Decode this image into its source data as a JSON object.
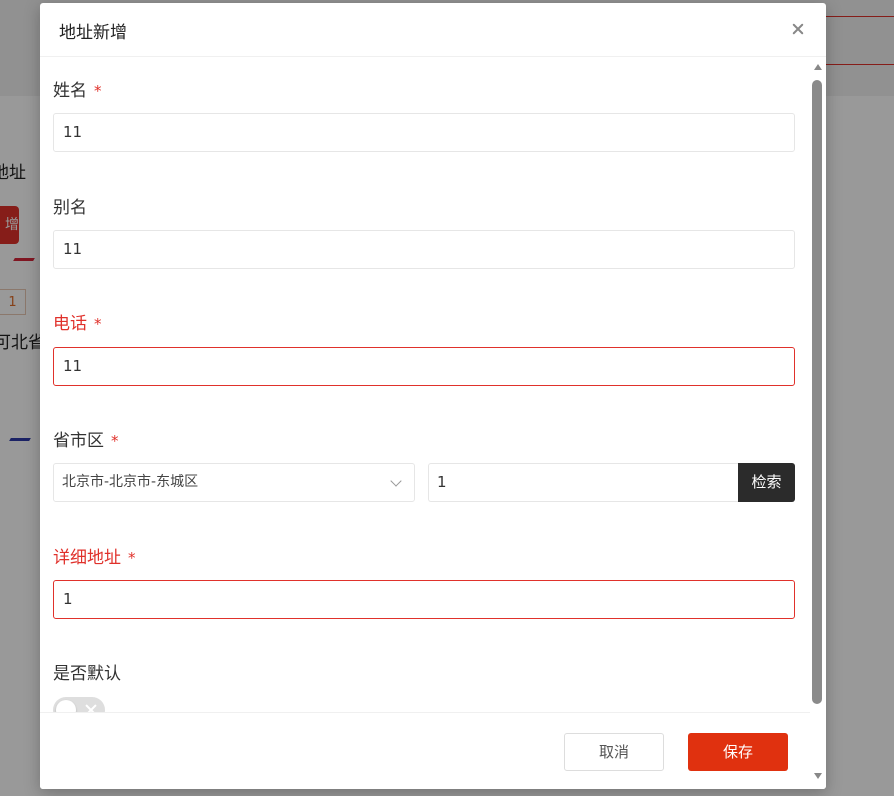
{
  "background": {
    "title_fragment": "地址",
    "button_fragment": "增",
    "tag_value": "1",
    "province_fragment": "可北省"
  },
  "modal": {
    "title": "地址新增",
    "required_mark": "*",
    "fields": {
      "name": {
        "label": "姓名",
        "value": "11"
      },
      "alias": {
        "label": "别名",
        "value": "11"
      },
      "phone": {
        "label": "电话",
        "value": "11"
      },
      "region": {
        "label": "省市区",
        "selected": "北京市-北京市-东城区",
        "search_value": "1",
        "search_button": "检索"
      },
      "detail": {
        "label": "详细地址",
        "value": "1"
      },
      "is_default": {
        "label": "是否默认",
        "checked": false
      }
    },
    "footer": {
      "cancel_label": "取消",
      "save_label": "保存"
    }
  },
  "colors": {
    "accent": "#e0310f",
    "error": "#e0312b",
    "search_button": "#2b2b2b"
  }
}
